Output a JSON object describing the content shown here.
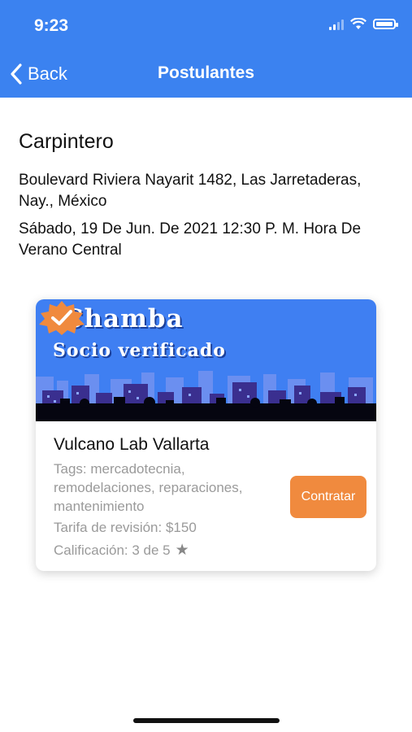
{
  "status": {
    "time": "9:23"
  },
  "nav": {
    "back_label": "Back",
    "title": "Postulantes"
  },
  "job": {
    "title": "Carpintero",
    "address": "Boulevard Riviera Nayarit 1482, Las Jarretaderas, Nay., México",
    "date": "Sábado, 19 De Jun. De 2021 12:30 P. M. Hora De Verano Central"
  },
  "card": {
    "banner_logo": "iChamba",
    "banner_subtitle": "Socio verificado",
    "provider_name": "Vulcano Lab Vallarta",
    "tags": "Tags: mercadotecnia, remodelaciones, reparaciones, mantenimiento",
    "rate": "Tarifa de revisión: $150",
    "rating": "Calificación: 3 de 5",
    "hire_label": "Contratar",
    "accent_color": "#f08a3e"
  },
  "colors": {
    "header": "#3b82f0",
    "banner": "#3f7ff2"
  }
}
